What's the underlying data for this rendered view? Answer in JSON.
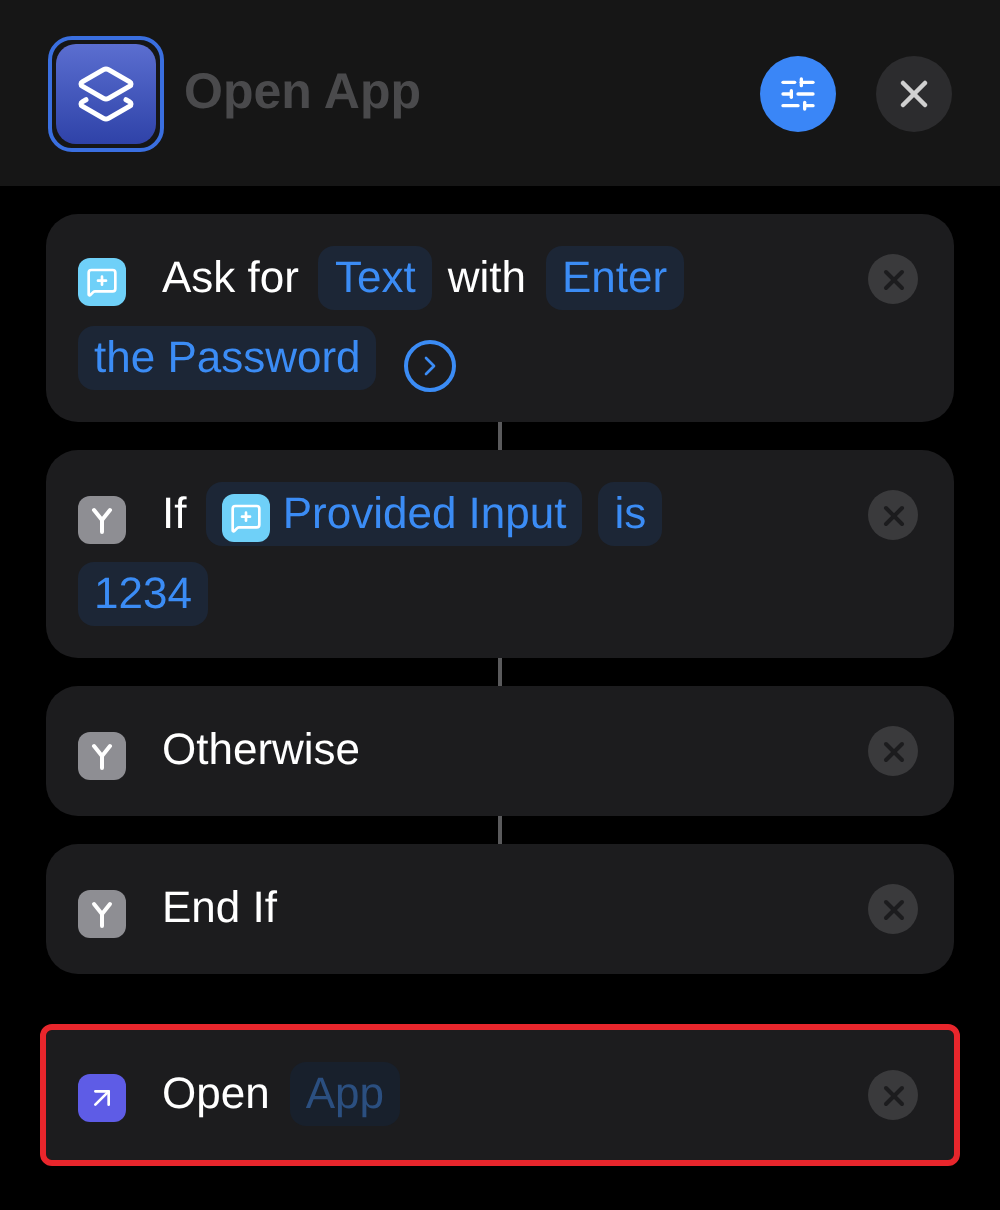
{
  "header": {
    "title": "Open App"
  },
  "actions": [
    {
      "kind": "ask",
      "linked_below": true,
      "highlighted": false,
      "parts": [
        {
          "kind": "word",
          "text": "Ask for"
        },
        {
          "kind": "token",
          "text": "Text"
        },
        {
          "kind": "word",
          "text": "with"
        },
        {
          "kind": "token",
          "text": "Enter"
        },
        {
          "kind": "token",
          "text": "the Password"
        },
        {
          "kind": "more"
        }
      ]
    },
    {
      "kind": "branch",
      "linked_below": true,
      "highlighted": false,
      "parts": [
        {
          "kind": "word",
          "text": "If"
        },
        {
          "kind": "token",
          "text": "Provided Input",
          "with_icon": true
        },
        {
          "kind": "token",
          "text": "is"
        },
        {
          "kind": "token",
          "text": "1234"
        }
      ]
    },
    {
      "kind": "branch",
      "linked_below": true,
      "highlighted": false,
      "parts": [
        {
          "kind": "word",
          "text": "Otherwise"
        }
      ]
    },
    {
      "kind": "branch",
      "linked_below": false,
      "highlighted": false,
      "parts": [
        {
          "kind": "word",
          "text": "End If"
        }
      ]
    },
    {
      "kind": "open",
      "linked_below": false,
      "highlighted": true,
      "parts": [
        {
          "kind": "word",
          "text": "Open"
        },
        {
          "kind": "placeholder",
          "text": "App"
        }
      ]
    }
  ]
}
